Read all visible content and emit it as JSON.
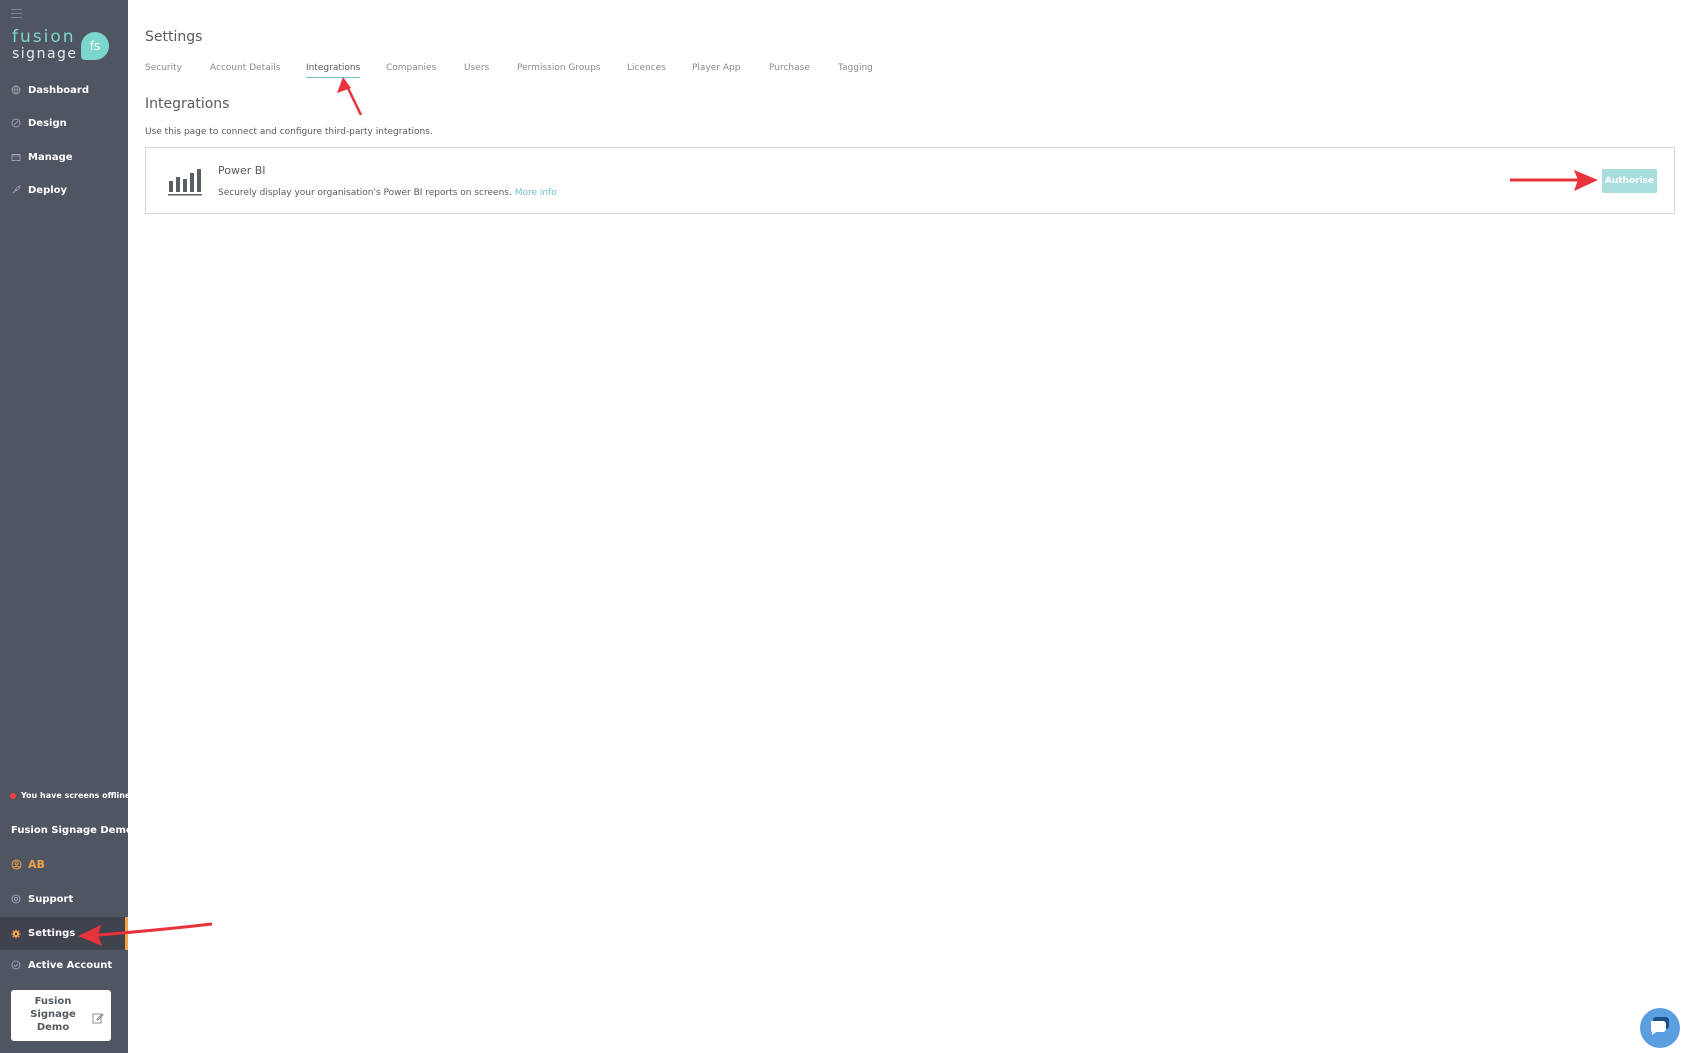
{
  "sidebar": {
    "logo": {
      "line1": "fusion",
      "line2": "signage",
      "badge": "fs"
    },
    "nav": [
      {
        "label": "Dashboard",
        "icon": "globe-icon"
      },
      {
        "label": "Design",
        "icon": "design-icon"
      },
      {
        "label": "Manage",
        "icon": "folder-icon"
      },
      {
        "label": "Deploy",
        "icon": "rocket-icon"
      }
    ],
    "offline_notice": "You have screens offline",
    "company_name": "Fusion Signage Demo",
    "user_initials": "AB",
    "bottom_nav": [
      {
        "label": "Support",
        "icon": "support-icon"
      },
      {
        "label": "Settings",
        "icon": "gear-icon"
      },
      {
        "label": "Active Account",
        "icon": "check-circle-icon"
      }
    ],
    "account_box": {
      "name": "Fusion Signage Demo"
    }
  },
  "main": {
    "title": "Settings",
    "tabs": [
      {
        "label": "Security"
      },
      {
        "label": "Account Details"
      },
      {
        "label": "Integrations"
      },
      {
        "label": "Companies"
      },
      {
        "label": "Users"
      },
      {
        "label": "Permission Groups"
      },
      {
        "label": "Licences"
      },
      {
        "label": "Player App"
      },
      {
        "label": "Purchase"
      },
      {
        "label": "Tagging"
      }
    ],
    "active_tab": "Integrations",
    "section_title": "Integrations",
    "section_description": "Use this page to connect and configure third-party integrations.",
    "integrations": [
      {
        "name": "Power BI",
        "description": "Securely display your organisation's Power BI reports on screens.",
        "more_info": "More info",
        "action": "Authorise"
      }
    ]
  },
  "colors": {
    "sidebar_bg": "#4f5561",
    "accent_teal": "#7dd5cf",
    "accent_orange": "#f0a24a",
    "button_bg": "#a9dedf",
    "annotation_red": "#e8323c"
  }
}
